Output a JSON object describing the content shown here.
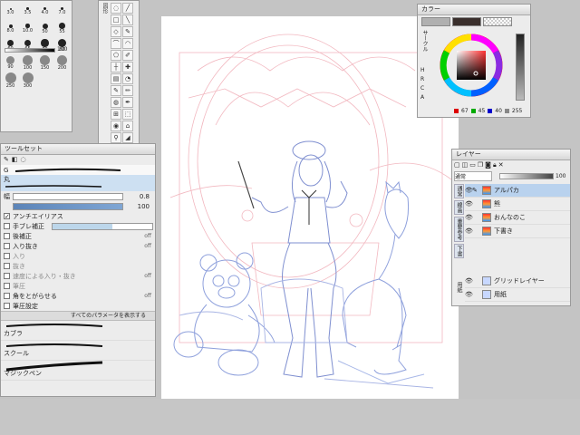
{
  "brush_size_panel": {
    "sizes": [
      "3.0",
      "3.5",
      "4.0",
      "7.0",
      "8.0",
      "10.0",
      "50",
      "55",
      "60",
      "65",
      "70",
      "80",
      "90",
      "100",
      "150",
      "200",
      "250",
      "300"
    ],
    "opacity_value": "100"
  },
  "tool_settings": {
    "title": "ツールセット",
    "current_brush": "丸",
    "size_label": "幅",
    "size_value": "0.8",
    "opacity_value": "100",
    "options": [
      {
        "label": "アンチエイリアス",
        "checked": true,
        "state": ""
      },
      {
        "label": "手ブレ補正",
        "checked": false,
        "state": ""
      },
      {
        "label": "後補正",
        "checked": false,
        "state": "off"
      },
      {
        "label": "入り抜き",
        "checked": false,
        "state": "off"
      },
      {
        "label": "入り",
        "checked": false,
        "state": ""
      },
      {
        "label": "抜き",
        "checked": false,
        "state": ""
      },
      {
        "label": "速度による入り・抜き",
        "checked": false,
        "state": "off"
      },
      {
        "label": "筆圧",
        "checked": false,
        "state": ""
      },
      {
        "label": "角をとがらせる",
        "checked": false,
        "state": "off"
      },
      {
        "label": "筆圧設定",
        "checked": false,
        "state": ""
      }
    ],
    "show_all_params": "すべてのパラメータを表示する",
    "brushes": [
      {
        "name": "カブラ"
      },
      {
        "name": "スクール"
      },
      {
        "name": "マジックペン"
      }
    ],
    "brush_header": "G"
  },
  "color_panel": {
    "title": "カラー",
    "side_label": "サークル",
    "bottom_tabs": [
      "H",
      "R",
      "C",
      "A"
    ],
    "r": "67",
    "g": "45",
    "b": "40",
    "a": "255",
    "colors": {
      "main": "#3a2f2c",
      "hue": "#ff4040"
    }
  },
  "layer_panel": {
    "title": "レイヤー",
    "blend_mode": "通常",
    "opacity": "100",
    "side_tabs": [
      "通常",
      "線画",
      "重要参考",
      "下書"
    ],
    "bottom_side_tab": "用紙",
    "layers": [
      {
        "name": "アルパカ",
        "selected": true
      },
      {
        "name": "熊",
        "selected": false
      },
      {
        "name": "おんなのこ",
        "selected": false
      },
      {
        "name": "下書き",
        "selected": false
      },
      {
        "name": "グリッドレイヤー",
        "selected": false
      },
      {
        "name": "用紙",
        "selected": false
      }
    ]
  }
}
